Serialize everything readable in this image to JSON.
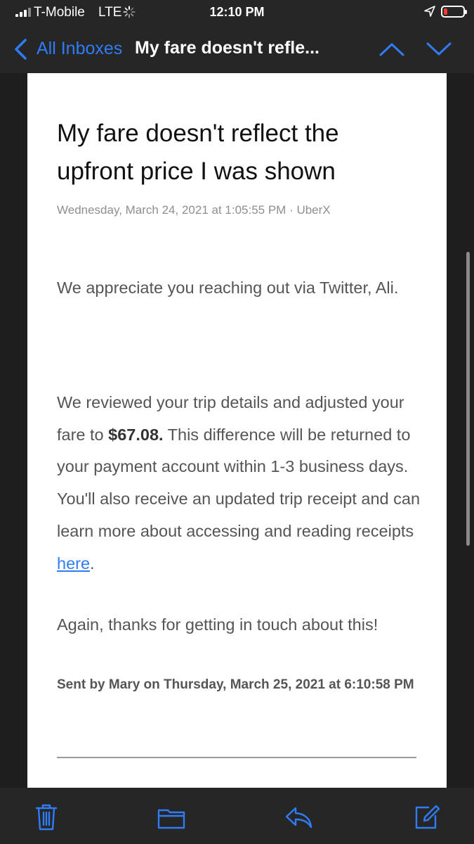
{
  "status_bar": {
    "carrier": "T-Mobile",
    "network": "LTE",
    "time": "12:10 PM",
    "battery_level": 0.1
  },
  "nav": {
    "back_label": "All Inboxes",
    "title": "My fare doesn't refle..."
  },
  "email": {
    "title": "My fare doesn't reflect the upfront price I was shown",
    "meta": "Wednesday, March 24, 2021 at 1:05:55 PM · UberX",
    "para1": "We appreciate you reaching out via Twitter, Ali.",
    "para2_before": "We reviewed your trip details and adjusted your fare to ",
    "para2_bold": "$67.08.",
    "para2_after": " This difference will be returned to your payment account within 1-3 business days. You'll also receive an updated trip receipt and can learn more about accessing and reading receipts ",
    "para2_link": "here",
    "para2_end": ".",
    "para3": "Again, thanks for getting in touch about this!",
    "signature": "Sent by Mary on Thursday, March 25, 2021 at 6:10:58 PM"
  },
  "toolbar": {
    "icons": [
      "trash-icon",
      "folder-icon",
      "reply-icon",
      "compose-icon"
    ]
  },
  "colors": {
    "accent": "#2f7cf6",
    "bar_background": "#262626",
    "battery_low": "#ff3b30"
  }
}
